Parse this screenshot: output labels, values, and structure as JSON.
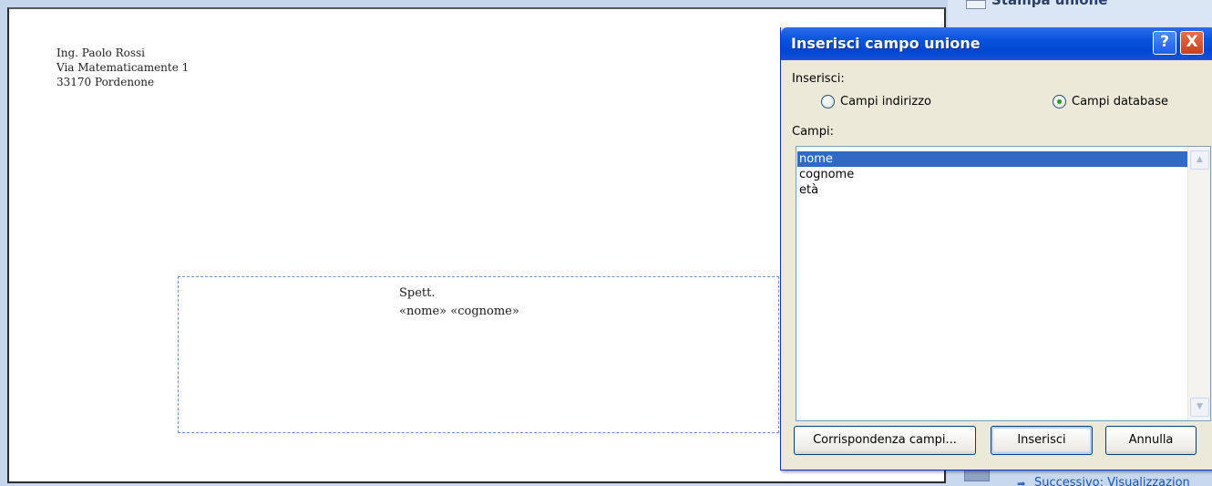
{
  "document": {
    "sender_lines": [
      "Ing. Paolo Rossi",
      "Via Matematicamente 1",
      "33170 Pordenone"
    ],
    "recipient_lines": [
      "Spett.",
      "«nome» «cognome»"
    ]
  },
  "task_pane": {
    "title": "Stampa unione",
    "next_step": "Successivo: Visualizzazion"
  },
  "dialog": {
    "title": "Inserisci campo unione",
    "help_label": "?",
    "close_label": "X",
    "insert_group_label": "Inserisci:",
    "radio_address": "Campi indirizzo",
    "radio_database": "Campi database",
    "selected_radio": "Campi database",
    "fields_label": "Campi:",
    "fields": [
      "nome",
      "cognome",
      "età"
    ],
    "selected_field": "nome",
    "buttons": {
      "match_fields": "Corrispondenza campi...",
      "insert": "Inserisci",
      "cancel": "Annulla"
    }
  },
  "colors": {
    "titlebar": "#0a55e0",
    "dialog_bg": "#ece9d8",
    "selection": "#316ac5"
  }
}
